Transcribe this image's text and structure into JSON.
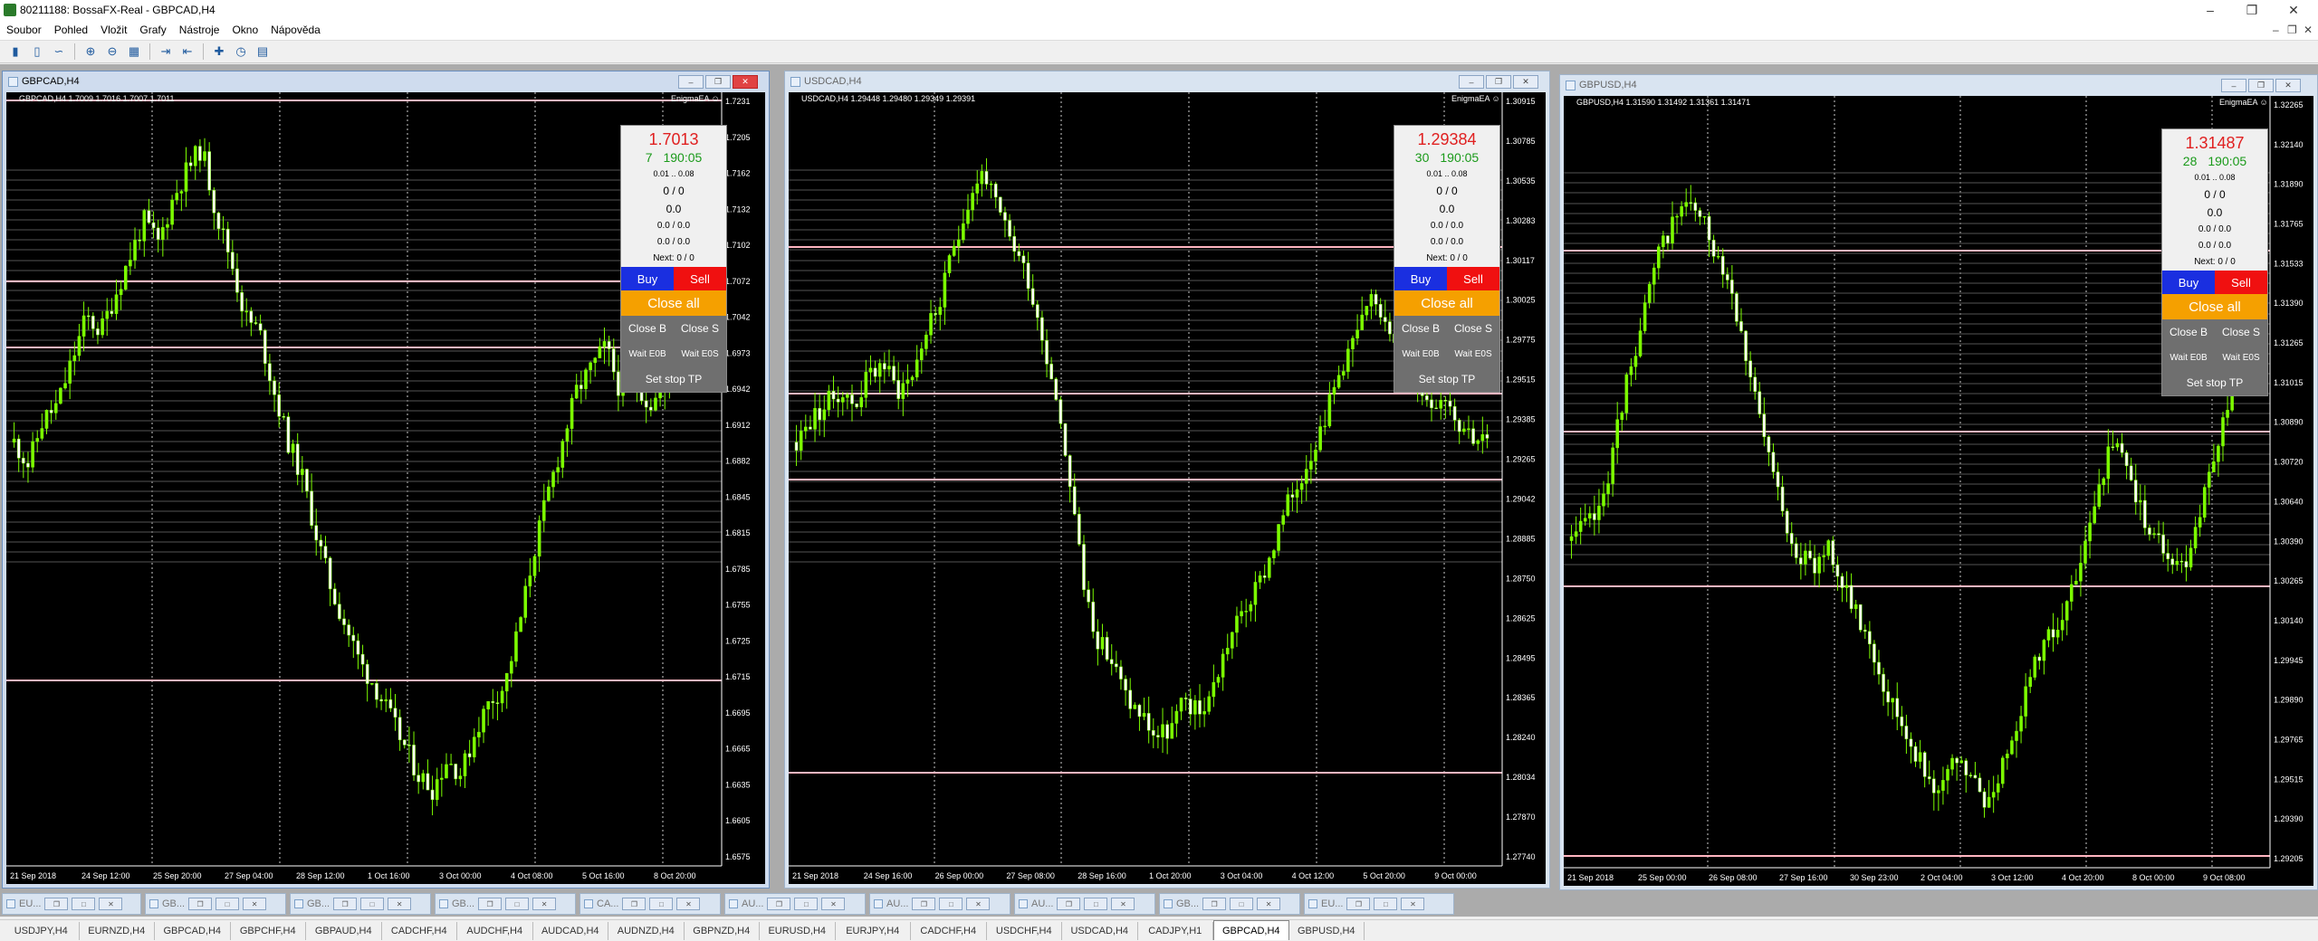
{
  "window": {
    "title": "80211188: BossaFX-Real - GBPCAD,H4"
  },
  "menu": [
    "Soubor",
    "Pohled",
    "Vložit",
    "Grafy",
    "Nástroje",
    "Okno",
    "Nápověda"
  ],
  "charts": [
    {
      "window_title": "GBPCAD,H4",
      "header": "GBPCAD,H4  1.7009 1.7016 1.7007 1.7011",
      "ea": "EnigmaEA",
      "price_labels": [
        "1.7231",
        "1.7205",
        "1.7162",
        "1.7132",
        "1.7102",
        "1.7072",
        "1.7042",
        "1.6973",
        "1.6942",
        "1.6912",
        "1.6882",
        "1.6845",
        "1.6815",
        "1.6785",
        "1.6755",
        "1.6725",
        "1.6715",
        "1.6695",
        "1.6665",
        "1.6635",
        "1.6605",
        "1.6575"
      ],
      "time_labels": [
        "21 Sep 2018",
        "24 Sep 12:00",
        "25 Sep 20:00",
        "27 Sep 04:00",
        "28 Sep 12:00",
        "1 Oct 16:00",
        "3 Oct 00:00",
        "4 Oct 08:00",
        "5 Oct 16:00",
        "8 Oct 20:00"
      ],
      "panel": {
        "price": "1.7013",
        "count": "7",
        "timer": "190:05",
        "lot": "0.01 .. 0.08",
        "orders": "0 / 0",
        "profit": "0.0",
        "pl": "0.0 / 0.0",
        "pl2": "0.0 / 0.0",
        "next": "Next: 0 / 0"
      }
    },
    {
      "window_title": "USDCAD,H4",
      "header": "USDCAD,H4  1.29448 1.29480 1.29349 1.29391",
      "ea": "EnigmaEA",
      "price_labels": [
        "1.30915",
        "1.30785",
        "1.30535",
        "1.30283",
        "1.30117",
        "1.30025",
        "1.29775",
        "1.29515",
        "1.29385",
        "1.29265",
        "1.29042",
        "1.28885",
        "1.28750",
        "1.28625",
        "1.28495",
        "1.28365",
        "1.28240",
        "1.28034",
        "1.27870",
        "1.27740"
      ],
      "time_labels": [
        "21 Sep 2018",
        "24 Sep 16:00",
        "26 Sep 00:00",
        "27 Sep 08:00",
        "28 Sep 16:00",
        "1 Oct 20:00",
        "3 Oct 04:00",
        "4 Oct 12:00",
        "5 Oct 20:00",
        "9 Oct 00:00"
      ],
      "panel": {
        "price": "1.29384",
        "count": "30",
        "timer": "190:05",
        "lot": "0.01 .. 0.08",
        "orders": "0 / 0",
        "profit": "0.0",
        "pl": "0.0 / 0.0",
        "pl2": "0.0 / 0.0",
        "next": "Next: 0 / 0"
      }
    },
    {
      "window_title": "GBPUSD,H4",
      "header": "GBPUSD,H4  1.31590 1.31492 1.31361 1.31471",
      "ea": "EnigmaEA",
      "price_labels": [
        "1.32265",
        "1.32140",
        "1.31890",
        "1.31765",
        "1.31533",
        "1.31390",
        "1.31265",
        "1.31015",
        "1.30890",
        "1.30720",
        "1.30640",
        "1.30390",
        "1.30265",
        "1.30140",
        "1.29945",
        "1.29890",
        "1.29765",
        "1.29515",
        "1.29390",
        "1.29205"
      ],
      "time_labels": [
        "21 Sep 2018",
        "25 Sep 00:00",
        "26 Sep 08:00",
        "27 Sep 16:00",
        "30 Sep 23:00",
        "2 Oct 04:00",
        "3 Oct 12:00",
        "4 Oct 20:00",
        "8 Oct 00:00",
        "9 Oct 08:00"
      ],
      "panel": {
        "price": "1.31487",
        "count": "28",
        "timer": "190:05",
        "lot": "0.01 .. 0.08",
        "orders": "0 / 0",
        "profit": "0.0",
        "pl": "0.0 / 0.0",
        "pl2": "0.0 / 0.0",
        "next": "Next: 0 / 0"
      }
    }
  ],
  "panel_buttons": {
    "buy": "Buy",
    "sell": "Sell",
    "close_all": "Close all",
    "close_b": "Close B",
    "close_s": "Close S",
    "wait_eob": "Wait E0B",
    "wait_eos": "Wait E0S",
    "set_stop_tp": "Set stop TP"
  },
  "minimized": [
    "EU...",
    "GB...",
    "GB...",
    "GB...",
    "CA...",
    "AU...",
    "AU...",
    "AU...",
    "GB...",
    "EU..."
  ],
  "tabs": [
    "USDJPY,H4",
    "EURNZD,H4",
    "GBPCAD,H4",
    "GBPCHF,H4",
    "GBPAUD,H4",
    "CADCHF,H4",
    "AUDCHF,H4",
    "AUDCAD,H4",
    "AUDNZD,H4",
    "GBPNZD,H4",
    "EURUSD,H4",
    "EURJPY,H4",
    "CADCHF,H4",
    "USDCHF,H4",
    "USDCAD,H4",
    "CADJPY,H1",
    "GBPCAD,H4",
    "GBPUSD,H4"
  ],
  "active_tab": "GBPCAD,H4",
  "colors": {
    "bull": "#7cfc00",
    "bear": "#ffffff",
    "grid": "#444444",
    "hline": "#ffb6c1",
    "price_red": "#e02020"
  }
}
